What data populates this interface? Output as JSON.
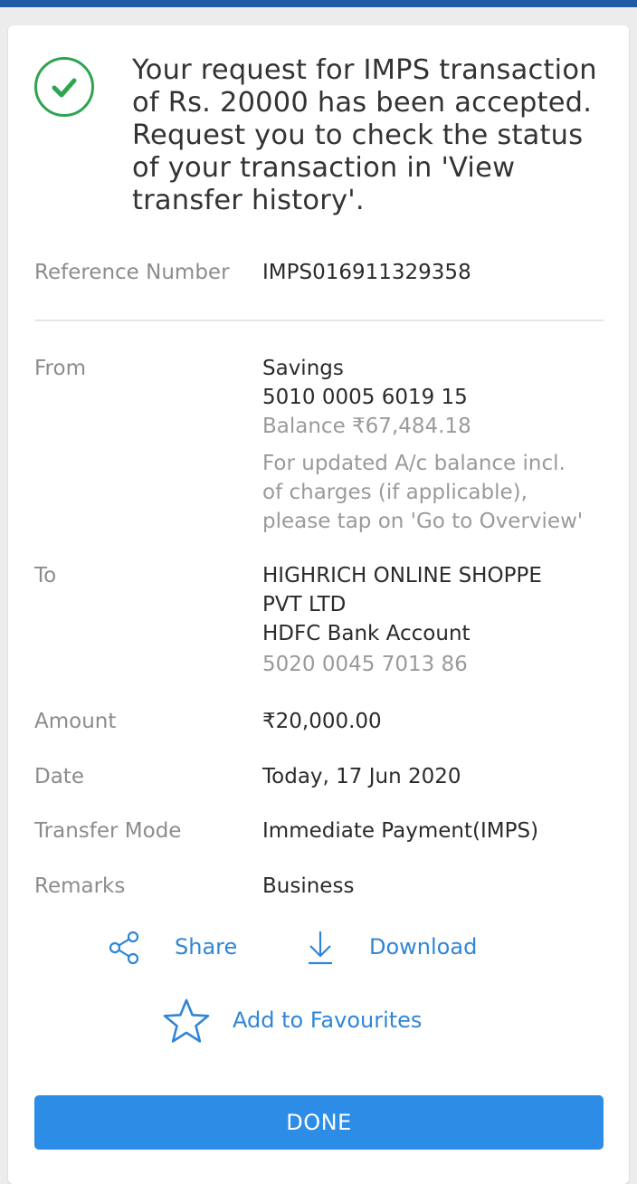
{
  "message": "Your request for IMPS transaction of Rs. 20000 has been accepted. Request you to check the status of your transaction in 'View transfer history'.",
  "reference": {
    "label": "Reference Number",
    "value": "IMPS016911329358"
  },
  "from": {
    "label": "From",
    "account_type": "Savings",
    "account_number": "5010 0005 6019 15",
    "balance": "Balance ₹67,484.18",
    "note_line1": "For updated A/c balance incl.",
    "note_line2": "of charges (if applicable),",
    "note_line3": "please tap on 'Go to Overview'"
  },
  "to": {
    "label": "To",
    "name_line1": "HIGHRICH ONLINE SHOPPE",
    "name_line2": "PVT LTD",
    "bank": "HDFC Bank Account",
    "account_number": "5020 0045 7013 86"
  },
  "amount": {
    "label": "Amount",
    "value": "₹20,000.00"
  },
  "date": {
    "label": "Date",
    "value": "Today, 17 Jun 2020"
  },
  "mode": {
    "label": "Transfer Mode",
    "value": "Immediate Payment(IMPS)"
  },
  "remarks": {
    "label": "Remarks",
    "value": "Business"
  },
  "actions": {
    "share": "Share",
    "download": "Download",
    "favourites": "Add to Favourites"
  },
  "done_label": "DONE",
  "colors": {
    "accent": "#2d8ce6",
    "link": "#2f86d6",
    "success": "#2ea44f",
    "topbar": "#1f5aa6"
  },
  "icons": [
    "check-circle-icon",
    "share-icon",
    "download-icon",
    "star-icon"
  ]
}
